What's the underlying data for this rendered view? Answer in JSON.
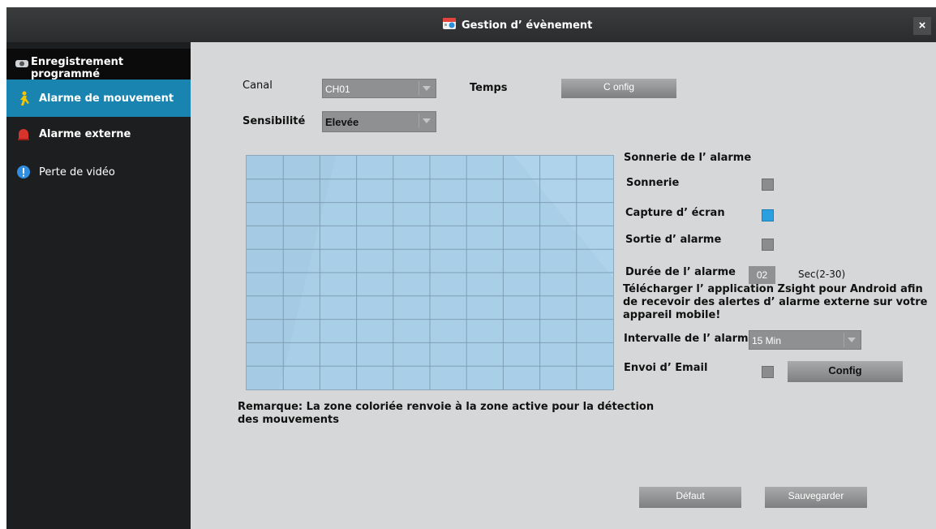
{
  "window": {
    "title": "Gestion d’ évènement",
    "close_label": "×"
  },
  "sidebar": {
    "items": [
      {
        "label": "Enregistrement programmé",
        "icon": "camera-icon",
        "active": false
      },
      {
        "label": "Alarme de mouvement",
        "icon": "running-man-icon",
        "active": true
      },
      {
        "label": "Alarme externe",
        "icon": "siren-icon",
        "active": false
      },
      {
        "label": "Perte de vidéo",
        "icon": "warning-icon",
        "active": false
      }
    ]
  },
  "motion": {
    "canal_label": "Canal",
    "canal_value": "CH01",
    "temps_label": "Temps",
    "temps_button": "C onfig",
    "sensibilite_label": "Sensibilité",
    "sensibilite_value": "Elevée",
    "sonnerie_section": "Sonnerie de l’ alarme",
    "sonnerie_label": "Sonnerie",
    "sonnerie_checked": false,
    "capture_label": "Capture d’ écran",
    "capture_checked": true,
    "sortie_label": "Sortie d’ alarme",
    "sortie_checked": false,
    "duree_label": "Durée de l’ alarme",
    "duree_value": "02",
    "duree_unit": "Sec(2-30)",
    "download_msg": "Télécharger l’ application Zsight pour Android afin de recevoir des alertes d’ alarme externe sur votre appareil mobile!",
    "intervalle_label": "Intervalle de l’ alarme",
    "intervalle_value": "15 Min",
    "email_label": "Envoi d’ Email",
    "email_checked": false,
    "email_button": "Config",
    "note": "Remarque: La zone coloriée renvoie à la zone active pour la détection des mouvements",
    "default_button": "Défaut",
    "save_button": "Sauvegarder"
  },
  "colors": {
    "accent": "#1a84b1",
    "checked": "#2aa0e0",
    "zone": "#a9cfe8"
  }
}
